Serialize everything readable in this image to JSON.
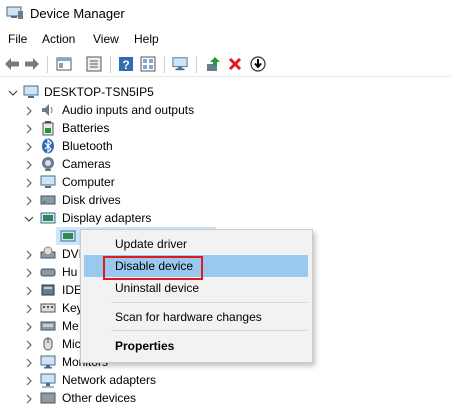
{
  "window": {
    "title": "Device Manager"
  },
  "menu": {
    "file": "File",
    "action": "Action",
    "view": "View",
    "help": "Help"
  },
  "toolbar": {
    "icons": [
      "back-arrow-icon",
      "forward-arrow-icon",
      "properties-icon",
      "show-hide-icon",
      "help-icon",
      "view-icon",
      "monitor-icon",
      "update-driver-icon",
      "uninstall-icon",
      "download-icon"
    ],
    "accent_red": "#e01a1a",
    "accent_blue": "#2f6db5",
    "accent_green": "#1e9a3a"
  },
  "tree": {
    "root": "DESKTOP-TSN5IP5",
    "items": [
      {
        "label": "Audio inputs and outputs",
        "icon": "speaker-icon"
      },
      {
        "label": "Batteries",
        "icon": "battery-icon"
      },
      {
        "label": "Bluetooth",
        "icon": "bluetooth-icon"
      },
      {
        "label": "Cameras",
        "icon": "camera-icon"
      },
      {
        "label": "Computer",
        "icon": "computer-icon"
      },
      {
        "label": "Disk drives",
        "icon": "disk-drive-icon"
      },
      {
        "label": "Display adapters",
        "icon": "display-adapter-icon"
      },
      {
        "label": "",
        "icon": "display-adapter-device-icon"
      },
      {
        "label": "DVI",
        "icon": "dvd-icon"
      },
      {
        "label": "Hu",
        "icon": "hid-icon"
      },
      {
        "label": "IDE",
        "icon": "ide-icon"
      },
      {
        "label": "Key",
        "icon": "keyboard-icon"
      },
      {
        "label": "Me",
        "icon": "memory-icon"
      },
      {
        "label": "Mic",
        "icon": "mice-icon"
      },
      {
        "label": "Monitors",
        "icon": "monitor-icon"
      },
      {
        "label": "Network adapters",
        "icon": "network-adapter-icon"
      },
      {
        "label": "Other devices",
        "icon": "other-devices-icon"
      }
    ]
  },
  "context_menu": {
    "update_driver": "Update driver",
    "disable_device": "Disable device",
    "uninstall_device": "Uninstall device",
    "scan": "Scan for hardware changes",
    "properties": "Properties",
    "highlight_color": "#99c9ef"
  }
}
